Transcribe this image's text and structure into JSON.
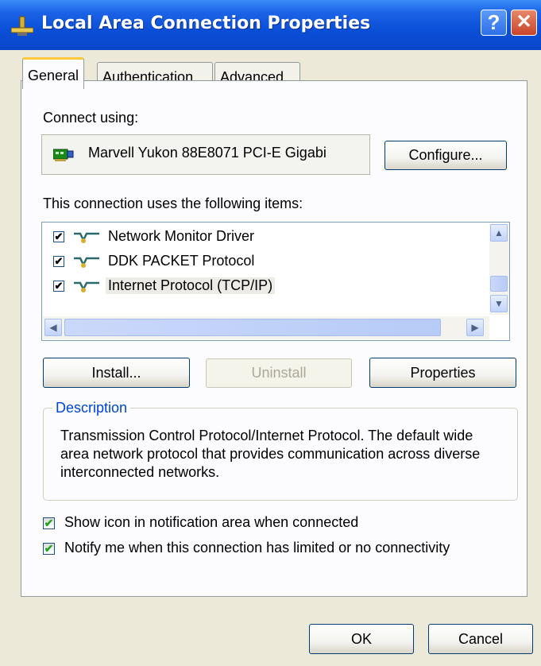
{
  "window": {
    "title": "Local Area Connection Properties",
    "help_glyph": "?",
    "close_glyph": "✕",
    "icons": [
      "network-connection-icon",
      "help-icon",
      "close-icon"
    ]
  },
  "tabs": [
    {
      "label": "General",
      "active": true
    },
    {
      "label": "Authentication",
      "active": false
    },
    {
      "label": "Advanced",
      "active": false
    }
  ],
  "general": {
    "connect_using_label": "Connect using:",
    "adapter_name": "Marvell Yukon 88E8071 PCI-E Gigabi",
    "adapter_icon": "network-adapter-icon",
    "configure_button": "Configure...",
    "items_label": "This connection uses the following items:",
    "items": [
      {
        "label": "Network Monitor Driver",
        "checked": true,
        "icon": "protocol-icon"
      },
      {
        "label": "DDK PACKET Protocol",
        "checked": true,
        "icon": "protocol-icon"
      },
      {
        "label": "Internet Protocol (TCP/IP)",
        "checked": true,
        "icon": "protocol-icon",
        "selected": true
      }
    ],
    "check_glyph": "✔",
    "scroll_up": "▲",
    "scroll_down": "▼",
    "scroll_left": "◀",
    "scroll_right": "▶",
    "install_button": "Install...",
    "uninstall_button": "Uninstall",
    "properties_button": "Properties",
    "description_legend": "Description",
    "description_text": "Transmission Control Protocol/Internet Protocol. The default wide area network protocol that provides communication across diverse interconnected networks.",
    "show_icon_label": "Show icon in notification area when connected",
    "show_icon_checked": true,
    "notify_label": "Notify me when this connection has limited or no connectivity",
    "notify_checked": true
  },
  "footer": {
    "ok_button": "OK",
    "cancel_button": "Cancel"
  },
  "colors": {
    "titlebar": "#0a4fd8",
    "dialog_bg": "#ece9d8",
    "panel_bg": "#fcfcfe",
    "active_tab_accent": "#ffc83c",
    "group_legend": "#0046d5",
    "checkbox_check": "#21a121"
  }
}
